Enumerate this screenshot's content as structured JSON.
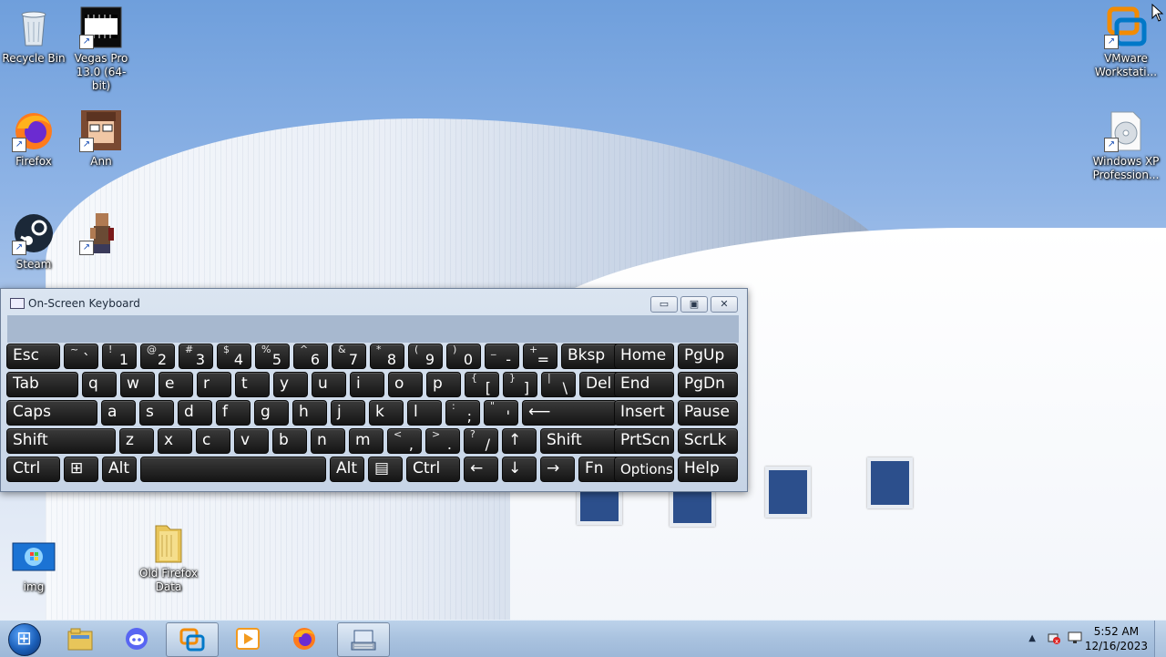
{
  "desktop": {
    "icons": [
      {
        "label": "Recycle Bin",
        "icon": "recycle-bin-icon"
      },
      {
        "label": "Vegas Pro 13.0 (64-bit)",
        "icon": "vegas-pro-icon"
      },
      {
        "label": "Firefox",
        "icon": "firefox-icon"
      },
      {
        "label": "Ann",
        "icon": "ann-avatar-icon"
      },
      {
        "label": "Steam",
        "icon": "steam-icon"
      },
      {
        "label": "",
        "icon": "pixel-character-icon"
      },
      {
        "label": "VMware Workstati...",
        "icon": "vmware-icon"
      },
      {
        "label": "Windows XP Profession...",
        "icon": "disc-image-icon"
      },
      {
        "label": "img",
        "icon": "image-file-icon"
      },
      {
        "label": "Old Firefox Data",
        "icon": "folder-icon"
      }
    ]
  },
  "osk": {
    "title": "On-Screen Keyboard",
    "controls": {
      "minimize": "▭",
      "maximize": "▣",
      "close": "✕"
    },
    "rows": [
      [
        {
          "l": "Esc"
        },
        {
          "s": "~",
          "m": "`"
        },
        {
          "s": "!",
          "m": "1"
        },
        {
          "s": "@",
          "m": "2"
        },
        {
          "s": "#",
          "m": "3"
        },
        {
          "s": "$",
          "m": "4"
        },
        {
          "s": "%",
          "m": "5"
        },
        {
          "s": "^",
          "m": "6"
        },
        {
          "s": "&",
          "m": "7"
        },
        {
          "s": "*",
          "m": "8"
        },
        {
          "s": "(",
          "m": "9"
        },
        {
          "s": ")",
          "m": "0"
        },
        {
          "s": "_",
          "m": "-"
        },
        {
          "s": "+",
          "m": "="
        },
        {
          "l": "Bksp"
        },
        {
          "l": "Home"
        },
        {
          "l": "PgUp"
        }
      ],
      [
        {
          "l": "Tab"
        },
        {
          "l": "q"
        },
        {
          "l": "w"
        },
        {
          "l": "e"
        },
        {
          "l": "r"
        },
        {
          "l": "t"
        },
        {
          "l": "y"
        },
        {
          "l": "u"
        },
        {
          "l": "i"
        },
        {
          "l": "o"
        },
        {
          "l": "p"
        },
        {
          "s": "{",
          "m": "["
        },
        {
          "s": "}",
          "m": "]"
        },
        {
          "s": "|",
          "m": "\\"
        },
        {
          "l": "Del"
        },
        {
          "l": "End"
        },
        {
          "l": "PgDn"
        }
      ],
      [
        {
          "l": "Caps"
        },
        {
          "l": "a"
        },
        {
          "l": "s"
        },
        {
          "l": "d"
        },
        {
          "l": "f"
        },
        {
          "l": "g"
        },
        {
          "l": "h"
        },
        {
          "l": "j"
        },
        {
          "l": "k"
        },
        {
          "l": "l"
        },
        {
          "s": ":",
          "m": ";"
        },
        {
          "s": "\"",
          "m": "'"
        },
        {
          "l": "⟵"
        },
        {
          "l": "Insert"
        },
        {
          "l": "Pause"
        }
      ],
      [
        {
          "l": "Shift"
        },
        {
          "l": "z"
        },
        {
          "l": "x"
        },
        {
          "l": "c"
        },
        {
          "l": "v"
        },
        {
          "l": "b"
        },
        {
          "l": "n"
        },
        {
          "l": "m"
        },
        {
          "s": "<",
          "m": ","
        },
        {
          "s": ">",
          "m": "."
        },
        {
          "s": "?",
          "m": "/"
        },
        {
          "l": "↑"
        },
        {
          "l": "Shift"
        },
        {
          "l": "PrtScn"
        },
        {
          "l": "ScrLk"
        }
      ],
      [
        {
          "l": "Ctrl"
        },
        {
          "l": "⊞"
        },
        {
          "l": "Alt"
        },
        {
          "l": ""
        },
        {
          "l": "Alt"
        },
        {
          "l": "▤"
        },
        {
          "l": "Ctrl"
        },
        {
          "l": "←"
        },
        {
          "l": "↓"
        },
        {
          "l": "→"
        },
        {
          "l": "Fn"
        },
        {
          "l": "Options"
        },
        {
          "l": "Help"
        }
      ]
    ]
  },
  "taskbar": {
    "apps": [
      {
        "name": "file-explorer",
        "icon": "folder-icon",
        "active": false
      },
      {
        "name": "discord",
        "icon": "discord-icon",
        "active": false
      },
      {
        "name": "vmware",
        "icon": "vmware-icon",
        "active": true
      },
      {
        "name": "media-player",
        "icon": "media-player-icon",
        "active": false
      },
      {
        "name": "firefox",
        "icon": "firefox-icon",
        "active": false
      },
      {
        "name": "on-screen-keyboard",
        "icon": "keyboard-icon",
        "active": true
      }
    ],
    "clock": {
      "time": "5:52 AM",
      "date": "12/16/2023"
    },
    "tray_icons": [
      "show-hidden-icons-icon",
      "network-error-icon",
      "display-icon"
    ]
  }
}
